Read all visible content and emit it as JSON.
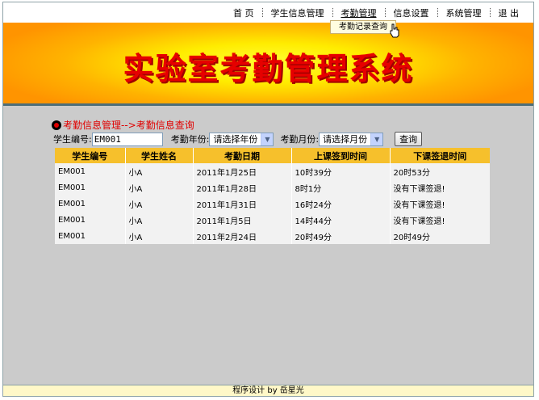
{
  "nav": {
    "items": [
      {
        "label": "首 页"
      },
      {
        "label": "学生信息管理"
      },
      {
        "label": "考勤管理"
      },
      {
        "label": "信息设置"
      },
      {
        "label": "系统管理"
      },
      {
        "label": "退 出"
      }
    ],
    "dropdown_item": "考勤记录查询"
  },
  "banner": {
    "title": "实验室考勤管理系统"
  },
  "breadcrumb": "考勤信息管理-->考勤信息查询",
  "search": {
    "student_id_label": "学生编号:",
    "student_id_value": "EM001",
    "year_label": "考勤年份:",
    "year_value": "请选择年份",
    "month_label": "考勤月份:",
    "month_value": "请选择月份",
    "query_label": "查询"
  },
  "table": {
    "headers": [
      "学生编号",
      "学生姓名",
      "考勤日期",
      "上课签到时间",
      "下课签退时间"
    ],
    "rows": [
      [
        "EM001",
        "小A",
        "2011年1月25日",
        "10时39分",
        "20时53分"
      ],
      [
        "EM001",
        "小A",
        "2011年1月28日",
        "8时1分",
        "没有下课签退!"
      ],
      [
        "EM001",
        "小A",
        "2011年1月31日",
        "16时24分",
        "没有下课签退!"
      ],
      [
        "EM001",
        "小A",
        "2011年1月5日",
        "14时44分",
        "没有下课签退!"
      ],
      [
        "EM001",
        "小A",
        "2011年2月24日",
        "20时49分",
        "20时49分"
      ]
    ]
  },
  "footer": "程序设计 by 岳星光",
  "colors": {
    "banner_title": "#e60000",
    "header_bg": "#f6c02c",
    "breadcrumb": "#e00000",
    "page_bg": "#cbcbcb"
  }
}
